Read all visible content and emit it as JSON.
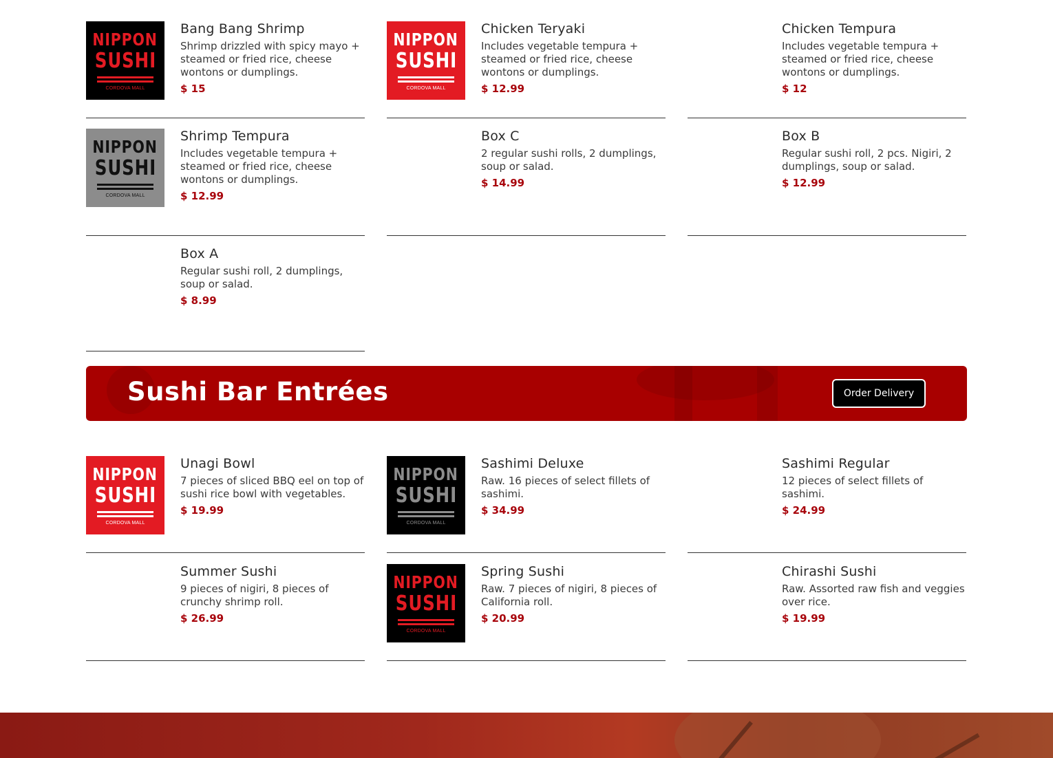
{
  "section1": {
    "items": [
      {
        "name": "Bang Bang Shrimp",
        "desc": "Shrimp drizzled with spicy mayo + steamed or fried rice, cheese wontons or dumplings.",
        "price": "$ 15",
        "has_thumb": true
      },
      {
        "name": "Chicken Teryaki",
        "desc": "Includes vegetable tempura + steamed or fried rice, cheese wontons or dumplings.",
        "price": "$ 12.99",
        "has_thumb": true
      },
      {
        "name": "Chicken Tempura",
        "desc": "Includes vegetable tempura + steamed or fried rice, cheese wontons or dumplings.",
        "price": "$ 12",
        "has_thumb": false
      },
      {
        "name": "Shrimp Tempura",
        "desc": "Includes vegetable tempura + steamed or fried rice, cheese wontons or dumplings.",
        "price": "$ 12.99",
        "has_thumb": true
      },
      {
        "name": "Box C",
        "desc": "2 regular sushi rolls, 2 dumplings, soup or salad.",
        "price": "$ 14.99",
        "has_thumb": false
      },
      {
        "name": "Box B",
        "desc": "Regular sushi roll, 2 pcs. Nigiri, 2 dumplings, soup or salad.",
        "price": "$ 12.99",
        "has_thumb": false
      },
      {
        "name": "Box A",
        "desc": "Regular sushi roll, 2 dumplings, soup or salad.",
        "price": "$ 8.99",
        "has_thumb": false
      }
    ]
  },
  "banner": {
    "title": "Sushi Bar Entrées",
    "button_label": "Order Delivery"
  },
  "section2": {
    "items": [
      {
        "name": "Unagi Bowl",
        "desc": "7 pieces of sliced BBQ eel on top of sushi rice bowl with vegetables.",
        "price": "$ 19.99",
        "has_thumb": true
      },
      {
        "name": "Sashimi Deluxe",
        "desc": "Raw. 16 pieces of select fillets of sashimi.",
        "price": "$ 34.99",
        "has_thumb": true
      },
      {
        "name": "Sashimi Regular",
        "desc": "12 pieces of select fillets of sashimi.",
        "price": "$ 24.99",
        "has_thumb": false
      },
      {
        "name": "Summer Sushi",
        "desc": "9 pieces of nigiri, 8 pieces of crunchy shrimp roll.",
        "price": "$ 26.99",
        "has_thumb": false
      },
      {
        "name": "Spring Sushi",
        "desc": "Raw. 7 pieces of nigiri, 8 pieces of California roll.",
        "price": "$ 20.99",
        "has_thumb": true
      },
      {
        "name": "Chirashi Sushi",
        "desc": "Raw. Assorted raw fish and veggies over rice.",
        "price": "$ 19.99",
        "has_thumb": false
      }
    ]
  },
  "logo": {
    "line1": "NIPPON",
    "line2": "SUSHI",
    "line3": "CORDOVA MALL"
  },
  "colors": {
    "accent_red": "#e31b23",
    "price_red": "#a8050c",
    "banner_red": "#a80000"
  }
}
